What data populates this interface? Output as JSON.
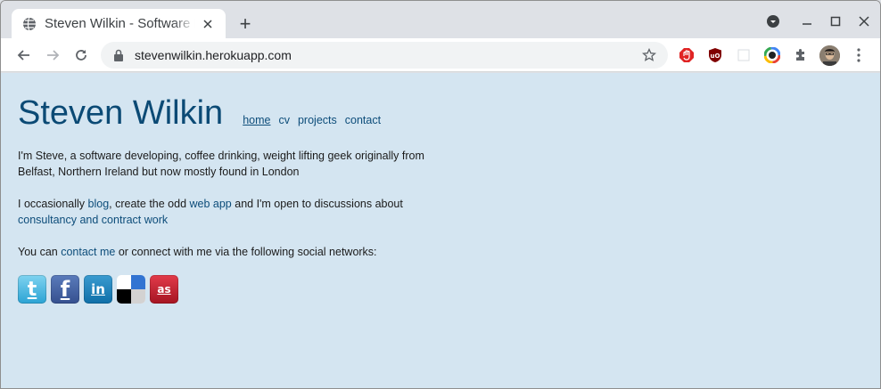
{
  "browser": {
    "tab": {
      "title": "Steven Wilkin - Software E",
      "favicon": "globe-icon"
    },
    "new_tab_label": "+",
    "url": "stevenwilkin.herokuapp.com",
    "extensions": [
      "stop-extension-icon",
      "ublock-icon",
      "blank-extension-icon",
      "color-extension-icon",
      "puzzle-icon"
    ]
  },
  "site": {
    "title": "Steven Wilkin",
    "nav": [
      {
        "label": "home",
        "active": true
      },
      {
        "label": "cv"
      },
      {
        "label": "projects"
      },
      {
        "label": "contact"
      }
    ],
    "p1": "I'm Steve, a software developing, coffee drinking, weight lifting geek originally from Belfast, Northern Ireland but now mostly found in London",
    "p2": {
      "t1": "I occasionally ",
      "l1": "blog",
      "t2": ", create the odd ",
      "l2": "web app",
      "t3": " and I'm open to discussions about ",
      "l3": "consultancy and contract work"
    },
    "p3": {
      "t1": "You can ",
      "l1": "contact me",
      "t2": " or connect with me via the following social networks:"
    },
    "social": [
      {
        "name": "twitter",
        "glyph": "t"
      },
      {
        "name": "facebook",
        "glyph": "f"
      },
      {
        "name": "linkedin",
        "glyph": "in"
      },
      {
        "name": "delicious",
        "glyph": ""
      },
      {
        "name": "lastfm",
        "glyph": "as"
      }
    ]
  },
  "colors": {
    "page_bg": "#d4e5f1",
    "title": "#0b4a75",
    "link": "#0d4d7a"
  }
}
